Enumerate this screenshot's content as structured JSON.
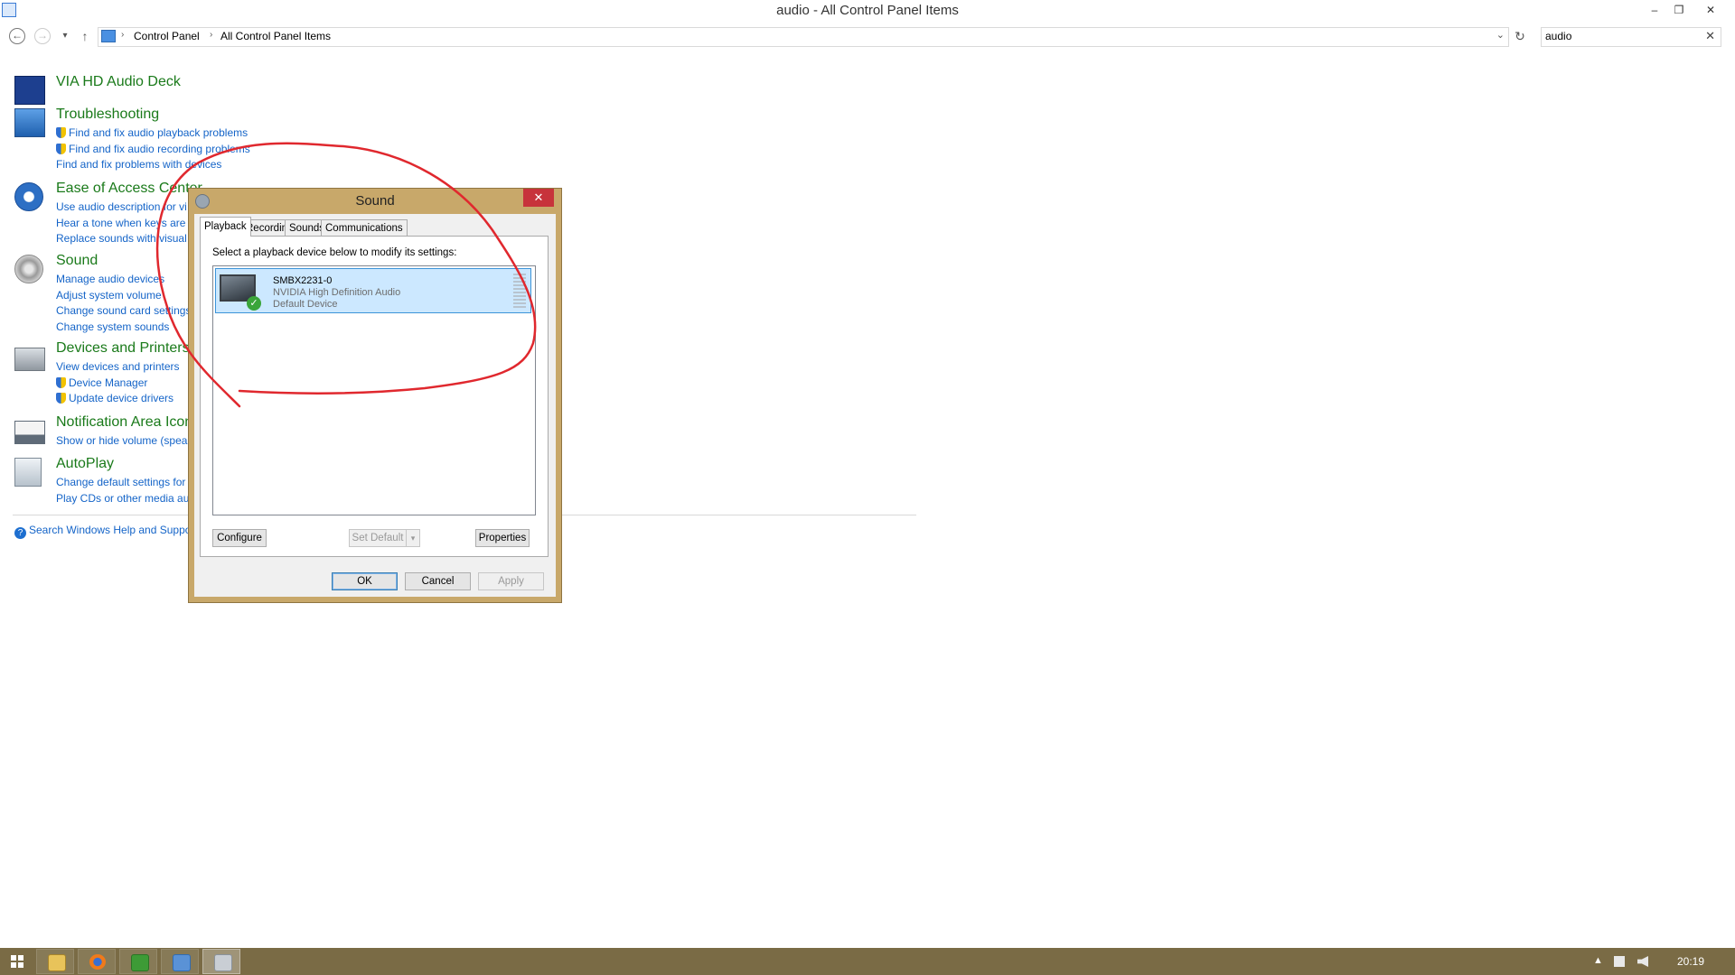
{
  "window": {
    "title": "audio - All Control Panel Items",
    "minimize": "–",
    "restore": "❐",
    "close": "✕"
  },
  "address": {
    "back": "←",
    "forward": "→",
    "dropdown": "▾",
    "up": "↑",
    "breadcrumb": [
      "Control Panel",
      "All Control Panel Items"
    ],
    "separator": "›",
    "address_dropdown": "⌄",
    "refresh": "↻",
    "search_value": "audio",
    "search_clear": "✕"
  },
  "groups": [
    {
      "title": "VIA HD Audio Deck",
      "icon": "via-hd-audio-icon",
      "links": []
    },
    {
      "title": "Troubleshooting",
      "icon": "troubleshooting-icon",
      "links": [
        {
          "text": "Find and fix audio playback problems",
          "shield": true
        },
        {
          "text": "Find and fix audio recording problems",
          "shield": true
        },
        {
          "text": "Find and fix problems with devices",
          "shield": false
        }
      ]
    },
    {
      "title": "Ease of Access Center",
      "icon": "ease-of-access-icon",
      "links": [
        {
          "text": "Use audio description for vi",
          "shield": false
        },
        {
          "text": "Hear a tone when keys are p",
          "shield": false
        },
        {
          "text": "Replace sounds with visual c",
          "shield": false
        }
      ]
    },
    {
      "title": "Sound",
      "icon": "speaker-icon",
      "links": [
        {
          "text": "Manage audio devices",
          "shield": false
        },
        {
          "text": "Adjust system volume",
          "shield": false
        },
        {
          "text": "Change sound card settings",
          "shield": false
        },
        {
          "text": "Change system sounds",
          "shield": false
        }
      ]
    },
    {
      "title": "Devices and Printers",
      "icon": "devices-printers-icon",
      "links": [
        {
          "text": "View devices and printers",
          "shield": false
        },
        {
          "text": "Device Manager",
          "shield": true
        },
        {
          "text": "Update device drivers",
          "shield": true
        }
      ]
    },
    {
      "title": "Notification Area Icon",
      "icon": "notification-area-icon",
      "links": [
        {
          "text": "Show or hide volume (speak",
          "shield": false
        }
      ]
    },
    {
      "title": "AutoPlay",
      "icon": "autoplay-icon",
      "links": [
        {
          "text": "Change default settings for",
          "shield": false
        },
        {
          "text": "Play CDs or other media aut",
          "shield": false
        }
      ]
    }
  ],
  "help_link": "Search Windows Help and Suppo",
  "help_icon_glyph": "?",
  "dialog": {
    "title": "Sound",
    "close": "✕",
    "tabs": [
      "Playback",
      "Recording",
      "Sounds",
      "Communications"
    ],
    "active_tab": "Playback",
    "instruction": "Select a playback device below to modify its settings:",
    "device": {
      "name": "SMBX2231-0",
      "driver": "NVIDIA High Definition Audio",
      "status": "Default Device",
      "check_glyph": "✓"
    },
    "buttons": {
      "configure": "Configure",
      "set_default": "Set Default",
      "set_default_arrow": "▾",
      "properties": "Properties",
      "ok": "OK",
      "cancel": "Cancel",
      "apply": "Apply"
    }
  },
  "annotation": {
    "color": "#e0282e"
  },
  "taskbar": {
    "apps": [
      "file-explorer-icon",
      "firefox-icon",
      "green-app-icon",
      "control-panel-icon",
      "sound-icon"
    ],
    "tray_up": "▲",
    "clock": "20:19"
  },
  "colors": {
    "dialog_frame": "#c8a86a",
    "taskbar": "#7a6b45",
    "link": "#1464c8",
    "group_title": "#1a7a1a",
    "selection": "#cce8ff"
  }
}
